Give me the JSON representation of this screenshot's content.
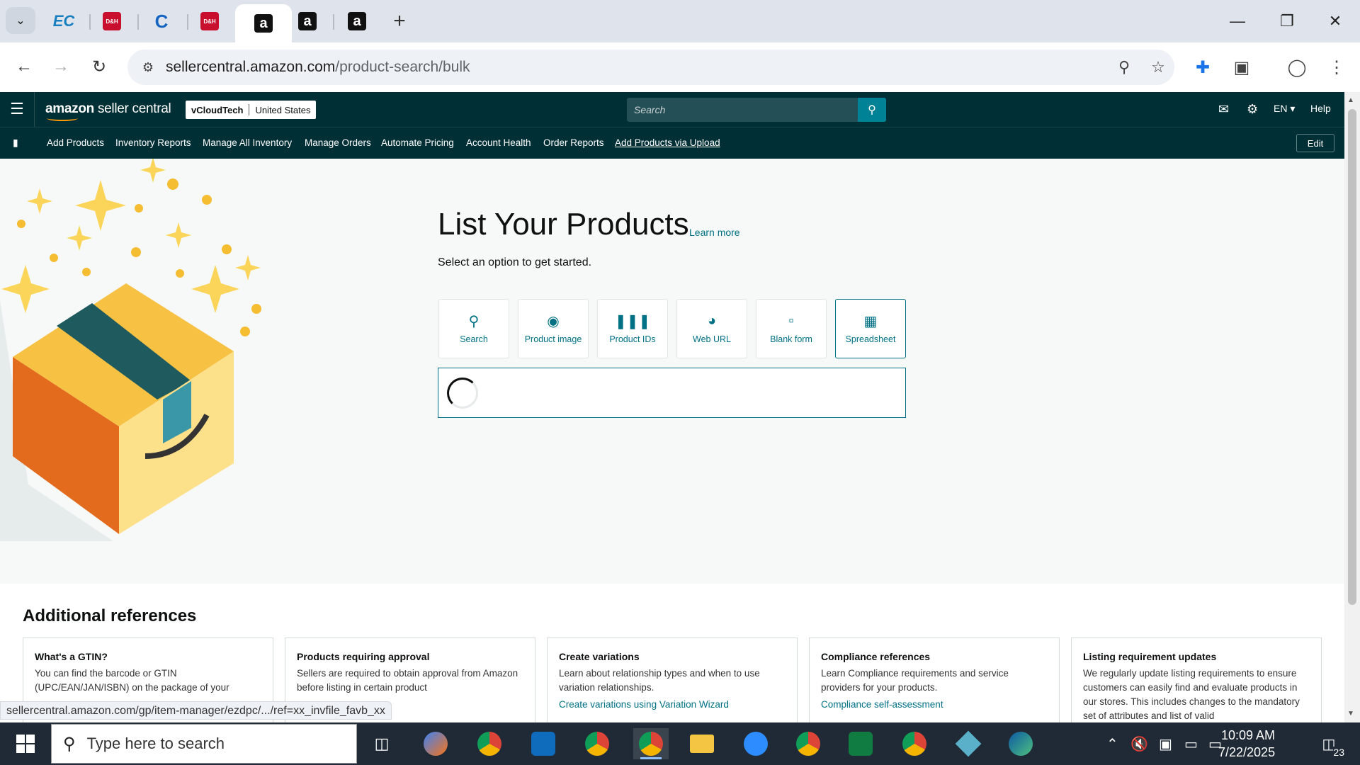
{
  "browser": {
    "tabs": [
      {
        "label": "EC"
      },
      {
        "label": "D&H"
      },
      {
        "label": "C"
      },
      {
        "label": "D&H"
      },
      {
        "label": "a",
        "active": true
      },
      {
        "label": "a"
      },
      {
        "label": "a"
      }
    ],
    "url_host": "sellercentral.amazon.com",
    "url_path": "/product-search/bulk",
    "status_url": "sellercentral.amazon.com/gp/item-manager/ezdpc/.../ref=xx_invfile_favb_xx"
  },
  "header": {
    "logo_brand": "amazon",
    "logo_product": "seller central",
    "account_name": "vCloudTech",
    "account_marketplace": "United States",
    "search_placeholder": "Search",
    "language": "EN",
    "help": "Help"
  },
  "nav": {
    "items": [
      "Add Products",
      "Inventory Reports",
      "Manage All Inventory",
      "Manage Orders",
      "Automate Pricing",
      "Account Health",
      "Order Reports",
      "Add Products via Upload"
    ],
    "edit": "Edit"
  },
  "main": {
    "title": "List Your Products",
    "learn_more": "Learn more",
    "subtitle": "Select an option to get started.",
    "options": [
      {
        "label": "Search",
        "icon": "search-icon"
      },
      {
        "label": "Product image",
        "icon": "camera-icon"
      },
      {
        "label": "Product IDs",
        "icon": "barcode-icon"
      },
      {
        "label": "Web URL",
        "icon": "globe-icon"
      },
      {
        "label": "Blank form",
        "icon": "document-icon"
      },
      {
        "label": "Spreadsheet",
        "icon": "spreadsheet-icon",
        "selected": true
      }
    ]
  },
  "refs": {
    "title": "Additional references",
    "cards": [
      {
        "title": "What's a GTIN?",
        "body": "You can find the barcode or GTIN (UPC/EAN/JAN/ISBN) on the package of your",
        "link": ""
      },
      {
        "title": "Products requiring approval",
        "body": "Sellers are required to obtain approval from Amazon before listing in certain product",
        "link": ""
      },
      {
        "title": "Create variations",
        "body": "Learn about relationship types and when to use variation relationships.",
        "link": "Create variations using Variation Wizard"
      },
      {
        "title": "Compliance references",
        "body": "Learn Compliance requirements and service providers for your products.",
        "link": "Compliance self-assessment"
      },
      {
        "title": "Listing requirement updates",
        "body": "We regularly update listing requirements to ensure customers can easily find and evaluate products in our stores. This includes changes to the mandatory set of attributes and list of valid",
        "link": ""
      }
    ]
  },
  "taskbar": {
    "search_placeholder": "Type here to search",
    "time": "10:09 AM",
    "date": "7/22/2025",
    "notifications": "23"
  },
  "colors": {
    "header_bg": "#002f36",
    "accent_teal": "#007185",
    "search_button": "#008296"
  }
}
